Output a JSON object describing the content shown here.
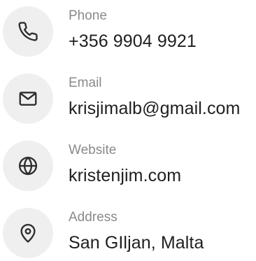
{
  "contacts": [
    {
      "icon": "phone-icon",
      "label": "Phone",
      "value": "+356 9904 9921"
    },
    {
      "icon": "mail-icon",
      "label": "Email",
      "value": "krisjimalb@gmail.com"
    },
    {
      "icon": "globe-icon",
      "label": "Website",
      "value": "kristenjim.com"
    },
    {
      "icon": "map-pin-icon",
      "label": "Address",
      "value": "San GIljan, Malta"
    }
  ],
  "colors": {
    "icon_background": "#efefef",
    "icon_stroke": "#2f2f2f",
    "label_text": "#8a8a8a",
    "value_text": "#1f1f1f"
  }
}
